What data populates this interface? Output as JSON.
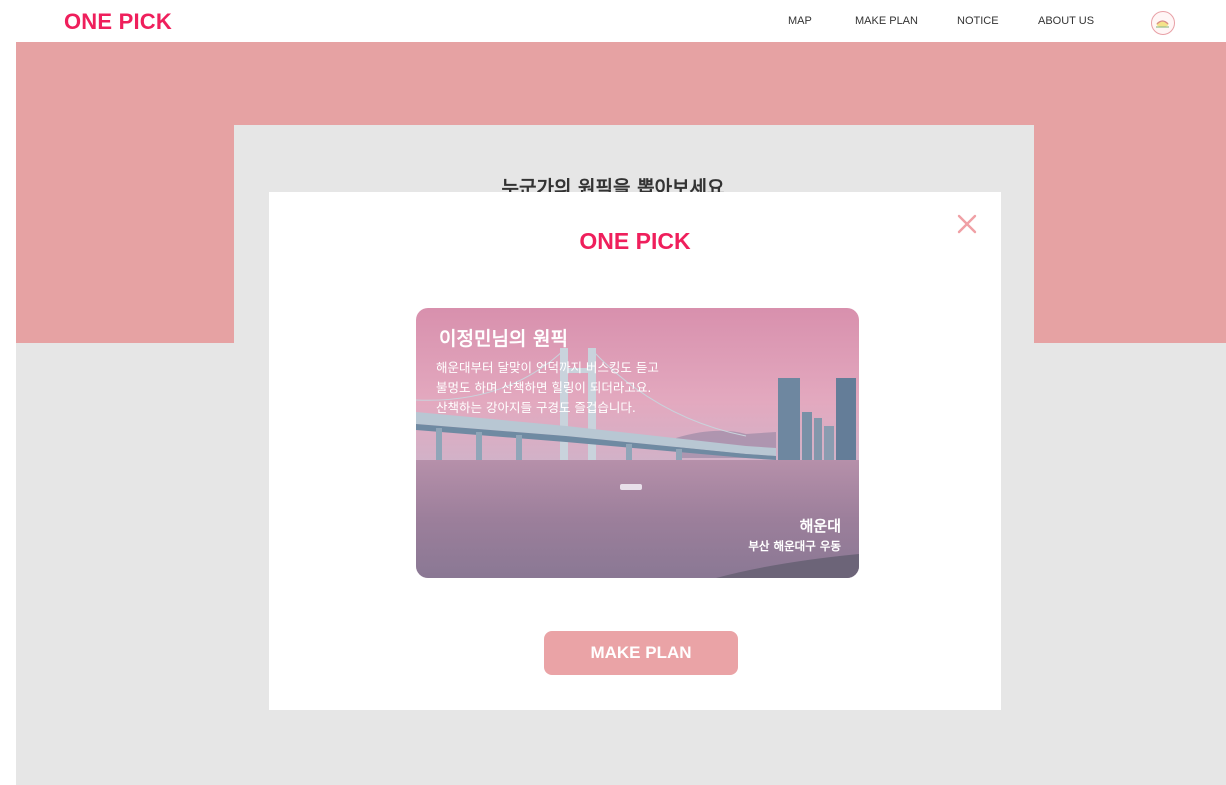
{
  "nav": {
    "logo": "ONE PICK",
    "links": [
      "MAP",
      "MAKE PLAN",
      "NOTICE",
      "ABOUT US"
    ]
  },
  "background": {
    "heading": "누군가의 원픽을 뽑아보세요"
  },
  "modal": {
    "logo": "ONE PICK",
    "card": {
      "title": "이정민님의 원픽",
      "description_lines": [
        "해운대부터 달맞이 언덕까지 버스킹도 듣고",
        "불멍도 하며 산책하면 힐링이 되더라고요.",
        "산책하는 강아지들 구경도 즐겁습니다."
      ],
      "place": "해운대",
      "address": "부산 해운대구 우동"
    },
    "button": "MAKE PLAN"
  },
  "icons": {
    "close": "close-icon",
    "profile": "avatar-icon"
  },
  "colors": {
    "brand": "#ef1f5c",
    "hero": "#e6a2a3",
    "button": "#eaa3a6",
    "close": "#f0a0a5"
  }
}
